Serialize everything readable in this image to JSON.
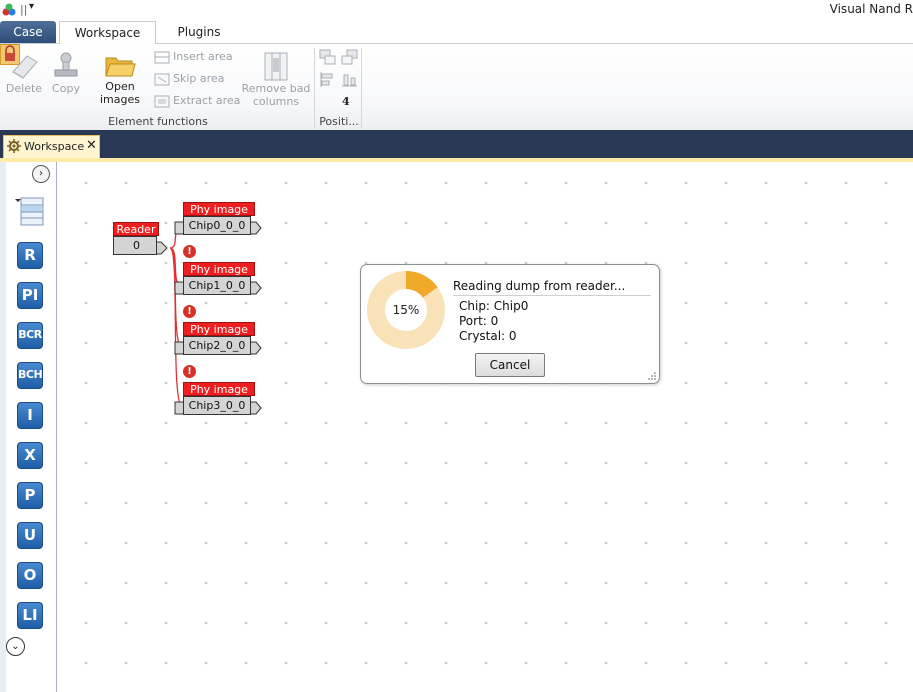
{
  "app": {
    "title": "Visual Nand R"
  },
  "ribbon": {
    "tabs": [
      {
        "label": "Case",
        "active": false
      },
      {
        "label": "Workspace",
        "active": true
      },
      {
        "label": "Plugins",
        "active": false
      }
    ],
    "buttons": {
      "delete": "Delete",
      "copy": "Copy",
      "open_images_line1": "Open",
      "open_images_line2": "images",
      "insert_area": "Insert area",
      "skip_area": "Skip area",
      "extract_area": "Extract area",
      "remove_bad_line1": "Remove bad",
      "remove_bad_line2": "columns"
    },
    "groups": {
      "element_functions": "Element functions",
      "position": "Positi...",
      "position_count": "4"
    }
  },
  "document_tab": {
    "label": "Workspace"
  },
  "toolbox": {
    "items": [
      "R",
      "PI",
      "BCR",
      "BCH",
      "I",
      "X",
      "P",
      "U",
      "O",
      "LI"
    ]
  },
  "nodes": {
    "reader": {
      "header": "Reader",
      "value": "0"
    },
    "chips": [
      {
        "header": "Phy image",
        "label": "Chip0_0_0"
      },
      {
        "header": "Phy image",
        "label": "Chip1_0_0"
      },
      {
        "header": "Phy image",
        "label": "Chip2_0_0"
      },
      {
        "header": "Phy image",
        "label": "Chip3_0_0"
      }
    ],
    "error_glyph": "!"
  },
  "progress_dialog": {
    "title": "Reading dump from reader...",
    "percent_label": "15%",
    "percent_value": 15,
    "chip": "Chip: Chip0",
    "port": "Port: 0",
    "crystal": "Crystal: 0",
    "cancel_label": "Cancel"
  },
  "colors": {
    "node_header": "#ef1f1f",
    "donut_track": "#f9e2b8",
    "donut_fill": "#f0a928",
    "toolbox_item": "#2a6cb8",
    "dock_bar": "#293955"
  }
}
